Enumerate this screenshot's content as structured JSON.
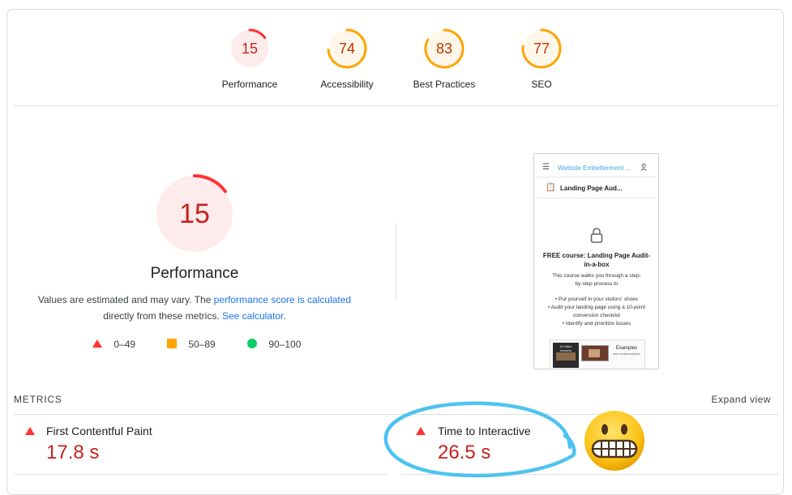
{
  "scores": [
    {
      "value": "15",
      "label": "Performance",
      "score": 0.15,
      "color": "#ff3333",
      "bg": "#fdeceb",
      "text": "#c5221f"
    },
    {
      "value": "74",
      "label": "Accessibility",
      "score": 0.74,
      "color": "#ffa400",
      "bg": "#fff7ea",
      "text": "#c33300"
    },
    {
      "value": "83",
      "label": "Best Practices",
      "score": 0.83,
      "color": "#ffa400",
      "bg": "#fff7ea",
      "text": "#c33300"
    },
    {
      "value": "77",
      "label": "SEO",
      "score": 0.77,
      "color": "#ffa400",
      "bg": "#fff7ea",
      "text": "#c33300"
    }
  ],
  "perf": {
    "score": "15",
    "title": "Performance",
    "desc_part1": "Values are estimated and may vary. The ",
    "desc_link1": "performance score is calculated",
    "desc_part2": "directly from these metrics. ",
    "desc_link2": "See calculator",
    "desc_end": "."
  },
  "legend": [
    {
      "range": "0–49",
      "icon": "triangle-fail"
    },
    {
      "range": "50–89",
      "icon": "square-average"
    },
    {
      "range": "90–100",
      "icon": "circle-pass"
    }
  ],
  "metrics": {
    "heading": "METRICS",
    "expand": "Expand view",
    "items": [
      {
        "name": "First Contentful Paint",
        "value": "17.8 s"
      },
      {
        "name": "Time to Interactive",
        "value": "26.5 s"
      }
    ]
  },
  "screenshot": {
    "nav_title": "Website Embetterment ...",
    "page_title": "Landing Page Aud...",
    "course_title": "FREE course: Landing Page Audit-in-a-box",
    "course_desc": "This course walks you through a step-by-step process to",
    "bullets": [
      "• Put yourself in your visitors' shoes",
      "• Audit your landing page using a 10-point conversion checklist",
      "• Identify and prioritize issues"
    ],
    "thumb_caption": "Examples",
    "thumb_subcaption": "and counterexamples",
    "thumb_left_text": "10 video lessons"
  },
  "colors": {
    "fail": "#ff3333",
    "average": "#ffa400",
    "pass": "#0cce6b",
    "highlight": "#4ec3f0"
  }
}
